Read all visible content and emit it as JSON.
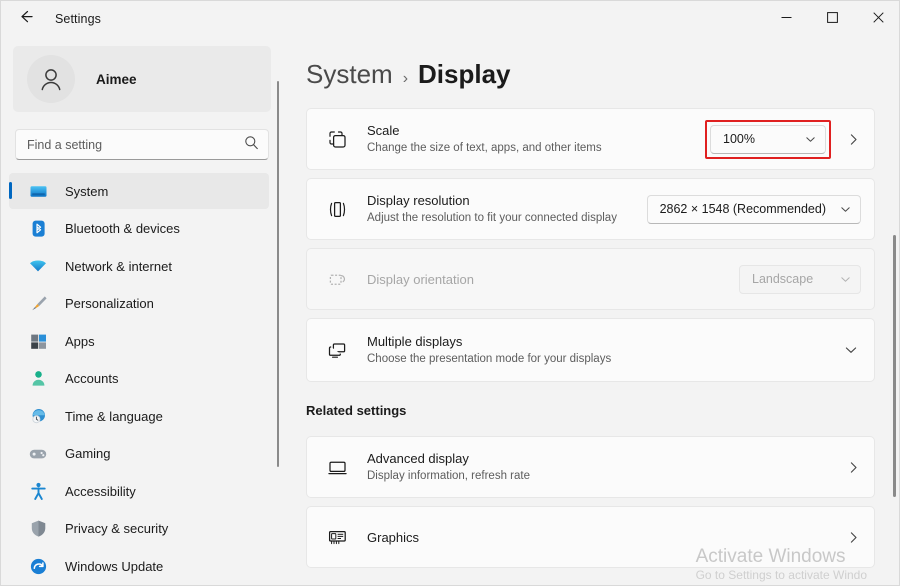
{
  "window": {
    "title": "Settings",
    "back_icon": "arrow-left-icon",
    "controls": {
      "minimize": "–",
      "maximize": "□",
      "close": "✕"
    }
  },
  "sidebar": {
    "account": {
      "name": "Aimee",
      "avatar_icon": "person-icon"
    },
    "search": {
      "placeholder": "Find a setting",
      "value": "",
      "icon": "search-icon"
    },
    "items": [
      {
        "label": "System",
        "icon": "monitor-icon",
        "selected": true
      },
      {
        "label": "Bluetooth & devices",
        "icon": "bluetooth-icon",
        "selected": false
      },
      {
        "label": "Network & internet",
        "icon": "wifi-icon",
        "selected": false
      },
      {
        "label": "Personalization",
        "icon": "paintbrush-icon",
        "selected": false
      },
      {
        "label": "Apps",
        "icon": "apps-icon",
        "selected": false
      },
      {
        "label": "Accounts",
        "icon": "account-icon",
        "selected": false
      },
      {
        "label": "Time & language",
        "icon": "clock-globe-icon",
        "selected": false
      },
      {
        "label": "Gaming",
        "icon": "gamepad-icon",
        "selected": false
      },
      {
        "label": "Accessibility",
        "icon": "accessibility-icon",
        "selected": false
      },
      {
        "label": "Privacy & security",
        "icon": "shield-icon",
        "selected": false
      },
      {
        "label": "Windows Update",
        "icon": "update-icon",
        "selected": false
      }
    ]
  },
  "main": {
    "breadcrumb": {
      "root": "System",
      "separator": "›",
      "current": "Display"
    },
    "settings": [
      {
        "title": "Scale",
        "subtitle": "Change the size of text, apps, and other items",
        "icon": "scale-icon",
        "value": "100%",
        "control": "combobox",
        "highlighted": true,
        "has_chevron_right": true,
        "disabled": false
      },
      {
        "title": "Display resolution",
        "subtitle": "Adjust the resolution to fit your connected display",
        "icon": "resolution-icon",
        "value": "2862 × 1548 (Recommended)",
        "control": "combobox",
        "highlighted": false,
        "has_chevron_right": false,
        "disabled": false
      },
      {
        "title": "Display orientation",
        "subtitle": "",
        "icon": "orientation-icon",
        "value": "Landscape",
        "control": "combobox",
        "highlighted": false,
        "has_chevron_right": false,
        "disabled": true
      },
      {
        "title": "Multiple displays",
        "subtitle": "Choose the presentation mode for your displays",
        "icon": "multiple-displays-icon",
        "value": "",
        "control": "expander",
        "highlighted": false,
        "has_chevron_right": false,
        "disabled": false
      }
    ],
    "related_heading": "Related settings",
    "related": [
      {
        "title": "Advanced display",
        "subtitle": "Display information, refresh rate",
        "icon": "advanced-display-icon"
      },
      {
        "title": "Graphics",
        "subtitle": "",
        "icon": "graphics-card-icon"
      }
    ]
  },
  "watermark": {
    "line1": "Activate Windows",
    "line2": "Go to Settings to activate Windo"
  },
  "colors": {
    "accent": "#0067c0",
    "highlight": "#e02020",
    "window_bg": "#f3f3f3",
    "card_bg": "#fbfbfb"
  }
}
